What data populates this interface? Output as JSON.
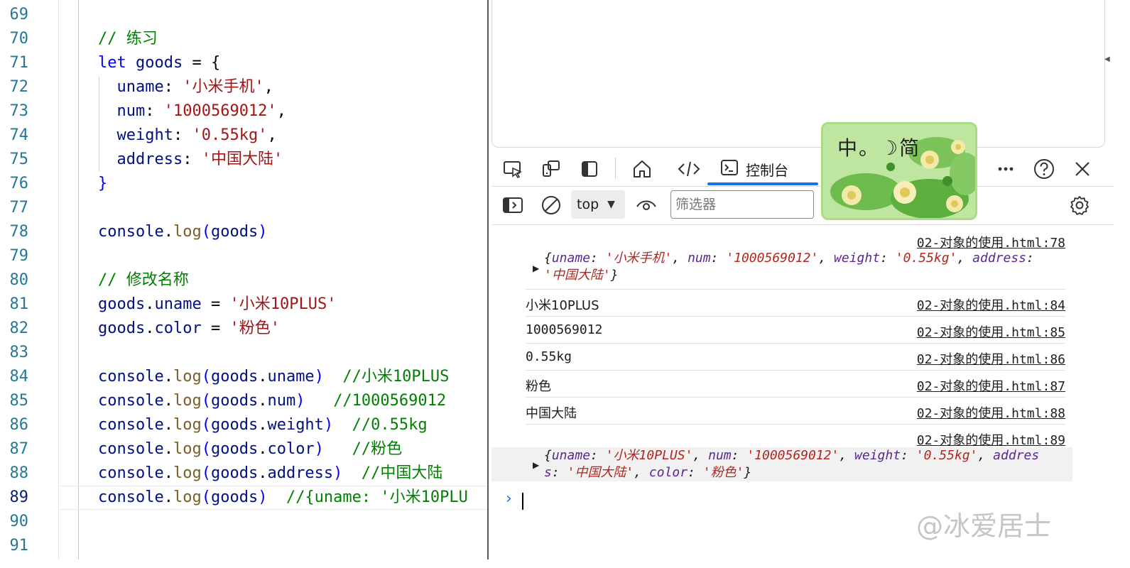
{
  "editor": {
    "lines": [
      {
        "num": "69",
        "tokens": []
      },
      {
        "num": "70",
        "tokens": [
          {
            "t": "// ",
            "c": "c"
          },
          {
            "t": "练习",
            "c": "c cjk"
          }
        ]
      },
      {
        "num": "71",
        "tokens": [
          {
            "t": "let",
            "c": "k"
          },
          {
            "t": " ",
            "c": "p"
          },
          {
            "t": "goods",
            "c": "v"
          },
          {
            "t": " = {",
            "c": "p"
          }
        ]
      },
      {
        "num": "72",
        "tokens": [
          {
            "t": "  uname",
            "c": "v"
          },
          {
            "t": ": ",
            "c": "p"
          },
          {
            "t": "'",
            "c": "s"
          },
          {
            "t": "小米手机",
            "c": "s cjk"
          },
          {
            "t": "'",
            "c": "s"
          },
          {
            "t": ",",
            "c": "p"
          }
        ]
      },
      {
        "num": "73",
        "tokens": [
          {
            "t": "  num",
            "c": "v"
          },
          {
            "t": ": ",
            "c": "p"
          },
          {
            "t": "'1000569012'",
            "c": "s"
          },
          {
            "t": ",",
            "c": "p"
          }
        ]
      },
      {
        "num": "74",
        "tokens": [
          {
            "t": "  weight",
            "c": "v"
          },
          {
            "t": ": ",
            "c": "p"
          },
          {
            "t": "'0.55kg'",
            "c": "s"
          },
          {
            "t": ",",
            "c": "p"
          }
        ]
      },
      {
        "num": "75",
        "tokens": [
          {
            "t": "  address",
            "c": "v"
          },
          {
            "t": ": ",
            "c": "p"
          },
          {
            "t": "'",
            "c": "s"
          },
          {
            "t": "中国大陆",
            "c": "s cjk"
          },
          {
            "t": "'",
            "c": "s"
          }
        ]
      },
      {
        "num": "76",
        "tokens": [
          {
            "t": "}",
            "c": "k"
          }
        ]
      },
      {
        "num": "77",
        "tokens": []
      },
      {
        "num": "78",
        "tokens": [
          {
            "t": "console",
            "c": "v"
          },
          {
            "t": ".",
            "c": "p"
          },
          {
            "t": "log",
            "c": "f"
          },
          {
            "t": "(",
            "c": "k"
          },
          {
            "t": "goods",
            "c": "v"
          },
          {
            "t": ")",
            "c": "k"
          }
        ]
      },
      {
        "num": "79",
        "tokens": []
      },
      {
        "num": "80",
        "tokens": [
          {
            "t": "// ",
            "c": "c"
          },
          {
            "t": "修改名称",
            "c": "c cjk"
          }
        ]
      },
      {
        "num": "81",
        "tokens": [
          {
            "t": "goods",
            "c": "v"
          },
          {
            "t": ".",
            "c": "p"
          },
          {
            "t": "uname",
            "c": "v"
          },
          {
            "t": " = ",
            "c": "p"
          },
          {
            "t": "'",
            "c": "s"
          },
          {
            "t": "小米",
            "c": "s cjk"
          },
          {
            "t": "10PLUS'",
            "c": "s"
          }
        ]
      },
      {
        "num": "82",
        "tokens": [
          {
            "t": "goods",
            "c": "v"
          },
          {
            "t": ".",
            "c": "p"
          },
          {
            "t": "color",
            "c": "v"
          },
          {
            "t": " = ",
            "c": "p"
          },
          {
            "t": "'",
            "c": "s"
          },
          {
            "t": "粉色",
            "c": "s cjk"
          },
          {
            "t": "'",
            "c": "s"
          }
        ]
      },
      {
        "num": "83",
        "tokens": []
      },
      {
        "num": "84",
        "tokens": [
          {
            "t": "console",
            "c": "v"
          },
          {
            "t": ".",
            "c": "p"
          },
          {
            "t": "log",
            "c": "f"
          },
          {
            "t": "(",
            "c": "k"
          },
          {
            "t": "goods",
            "c": "v"
          },
          {
            "t": ".",
            "c": "p"
          },
          {
            "t": "uname",
            "c": "v"
          },
          {
            "t": ")",
            "c": "k"
          },
          {
            "t": "  //",
            "c": "c"
          },
          {
            "t": "小米",
            "c": "c cjk"
          },
          {
            "t": "10PLUS",
            "c": "c"
          }
        ]
      },
      {
        "num": "85",
        "tokens": [
          {
            "t": "console",
            "c": "v"
          },
          {
            "t": ".",
            "c": "p"
          },
          {
            "t": "log",
            "c": "f"
          },
          {
            "t": "(",
            "c": "k"
          },
          {
            "t": "goods",
            "c": "v"
          },
          {
            "t": ".",
            "c": "p"
          },
          {
            "t": "num",
            "c": "v"
          },
          {
            "t": ")",
            "c": "k"
          },
          {
            "t": "   //1000569012",
            "c": "c"
          }
        ]
      },
      {
        "num": "86",
        "tokens": [
          {
            "t": "console",
            "c": "v"
          },
          {
            "t": ".",
            "c": "p"
          },
          {
            "t": "log",
            "c": "f"
          },
          {
            "t": "(",
            "c": "k"
          },
          {
            "t": "goods",
            "c": "v"
          },
          {
            "t": ".",
            "c": "p"
          },
          {
            "t": "weight",
            "c": "v"
          },
          {
            "t": ")",
            "c": "k"
          },
          {
            "t": "  //0.55kg",
            "c": "c"
          }
        ]
      },
      {
        "num": "87",
        "tokens": [
          {
            "t": "console",
            "c": "v"
          },
          {
            "t": ".",
            "c": "p"
          },
          {
            "t": "log",
            "c": "f"
          },
          {
            "t": "(",
            "c": "k"
          },
          {
            "t": "goods",
            "c": "v"
          },
          {
            "t": ".",
            "c": "p"
          },
          {
            "t": "color",
            "c": "v"
          },
          {
            "t": ")",
            "c": "k"
          },
          {
            "t": "   //",
            "c": "c"
          },
          {
            "t": "粉色",
            "c": "c cjk"
          }
        ]
      },
      {
        "num": "88",
        "tokens": [
          {
            "t": "console",
            "c": "v"
          },
          {
            "t": ".",
            "c": "p"
          },
          {
            "t": "log",
            "c": "f"
          },
          {
            "t": "(",
            "c": "k"
          },
          {
            "t": "goods",
            "c": "v"
          },
          {
            "t": ".",
            "c": "p"
          },
          {
            "t": "address",
            "c": "v"
          },
          {
            "t": ")",
            "c": "k"
          },
          {
            "t": "  //",
            "c": "c"
          },
          {
            "t": "中国大陆",
            "c": "c cjk"
          }
        ]
      },
      {
        "num": "89",
        "tokens": [
          {
            "t": "console",
            "c": "v"
          },
          {
            "t": ".",
            "c": "p"
          },
          {
            "t": "log",
            "c": "f"
          },
          {
            "t": "(",
            "c": "k"
          },
          {
            "t": "goods",
            "c": "v"
          },
          {
            "t": ")",
            "c": "k"
          },
          {
            "t": "  //{uname: '",
            "c": "c"
          },
          {
            "t": "小米",
            "c": "c cjk"
          },
          {
            "t": "10PLU",
            "c": "c"
          }
        ]
      },
      {
        "num": "90",
        "tokens": []
      },
      {
        "num": "91",
        "tokens": []
      }
    ],
    "active_line": "89"
  },
  "devtools": {
    "tab_console_label": "控制台",
    "context_value": "top",
    "filter_placeholder": "筛选器",
    "icons": {
      "inspect": "inspect-element-icon",
      "device": "device-emulation-icon",
      "sidebar": "toggle-sidebar-icon",
      "welcome": "home-icon",
      "elements": "code-brackets-icon",
      "console": "console-icon",
      "more": "more-tools-icon",
      "help": "help-icon",
      "close": "close-icon",
      "show_sidebar": "show-console-sidebar-icon",
      "clear": "clear-console-icon",
      "live_expression": "eye-icon",
      "settings": "gear-icon"
    }
  },
  "ime": {
    "label": "中。☽简"
  },
  "console": {
    "messages": [
      {
        "source": "02-对象的使用.html:78"
      },
      {
        "text": "小米10PLUS",
        "source": "02-对象的使用.html:84"
      },
      {
        "text": "1000569012",
        "source": "02-对象的使用.html:85"
      },
      {
        "text": "0.55kg",
        "source": "02-对象的使用.html:86"
      },
      {
        "text": "粉色",
        "source": "02-对象的使用.html:87"
      },
      {
        "text": "中国大陆",
        "source": "02-对象的使用.html:88"
      },
      {
        "source": "02-对象的使用.html:89"
      }
    ],
    "object1": {
      "line1": [
        {
          "t": "{",
          "c": ""
        },
        {
          "t": "uname",
          "c": "key"
        },
        {
          "t": ": ",
          "c": ""
        },
        {
          "t": "'小米手机'",
          "c": "str"
        },
        {
          "t": ", ",
          "c": ""
        },
        {
          "t": "num",
          "c": "key"
        },
        {
          "t": ": ",
          "c": ""
        },
        {
          "t": "'1000569012'",
          "c": "str"
        },
        {
          "t": ", ",
          "c": ""
        },
        {
          "t": "weight",
          "c": "key"
        },
        {
          "t": ": ",
          "c": ""
        },
        {
          "t": "'0.55kg'",
          "c": "str"
        },
        {
          "t": ", ",
          "c": ""
        },
        {
          "t": "address",
          "c": "key"
        },
        {
          "t": ":",
          "c": ""
        }
      ],
      "line2": [
        {
          "t": "'中国大陆'",
          "c": "str"
        },
        {
          "t": "}",
          "c": ""
        }
      ]
    },
    "object2": {
      "line1": [
        {
          "t": "{",
          "c": ""
        },
        {
          "t": "uname",
          "c": "key"
        },
        {
          "t": ": ",
          "c": ""
        },
        {
          "t": "'小米10PLUS'",
          "c": "str"
        },
        {
          "t": ", ",
          "c": ""
        },
        {
          "t": "num",
          "c": "key"
        },
        {
          "t": ": ",
          "c": ""
        },
        {
          "t": "'1000569012'",
          "c": "str"
        },
        {
          "t": ", ",
          "c": ""
        },
        {
          "t": "weight",
          "c": "key"
        },
        {
          "t": ": ",
          "c": ""
        },
        {
          "t": "'0.55kg'",
          "c": "str"
        },
        {
          "t": ", ",
          "c": ""
        },
        {
          "t": "addres",
          "c": "key"
        }
      ],
      "line2": [
        {
          "t": "s",
          "c": "key"
        },
        {
          "t": ": ",
          "c": ""
        },
        {
          "t": "'中国大陆'",
          "c": "str"
        },
        {
          "t": ", ",
          "c": ""
        },
        {
          "t": "color",
          "c": "key"
        },
        {
          "t": ": ",
          "c": ""
        },
        {
          "t": "'粉色'",
          "c": "str"
        },
        {
          "t": "}",
          "c": ""
        }
      ]
    },
    "prompt_symbol": "›"
  },
  "watermark": "@冰爱居士",
  "colors": {
    "keyword": "#0000ff",
    "variable": "#001080",
    "string": "#a31515",
    "comment": "#008000",
    "function": "#795e26",
    "accent": "#1a73e8"
  }
}
